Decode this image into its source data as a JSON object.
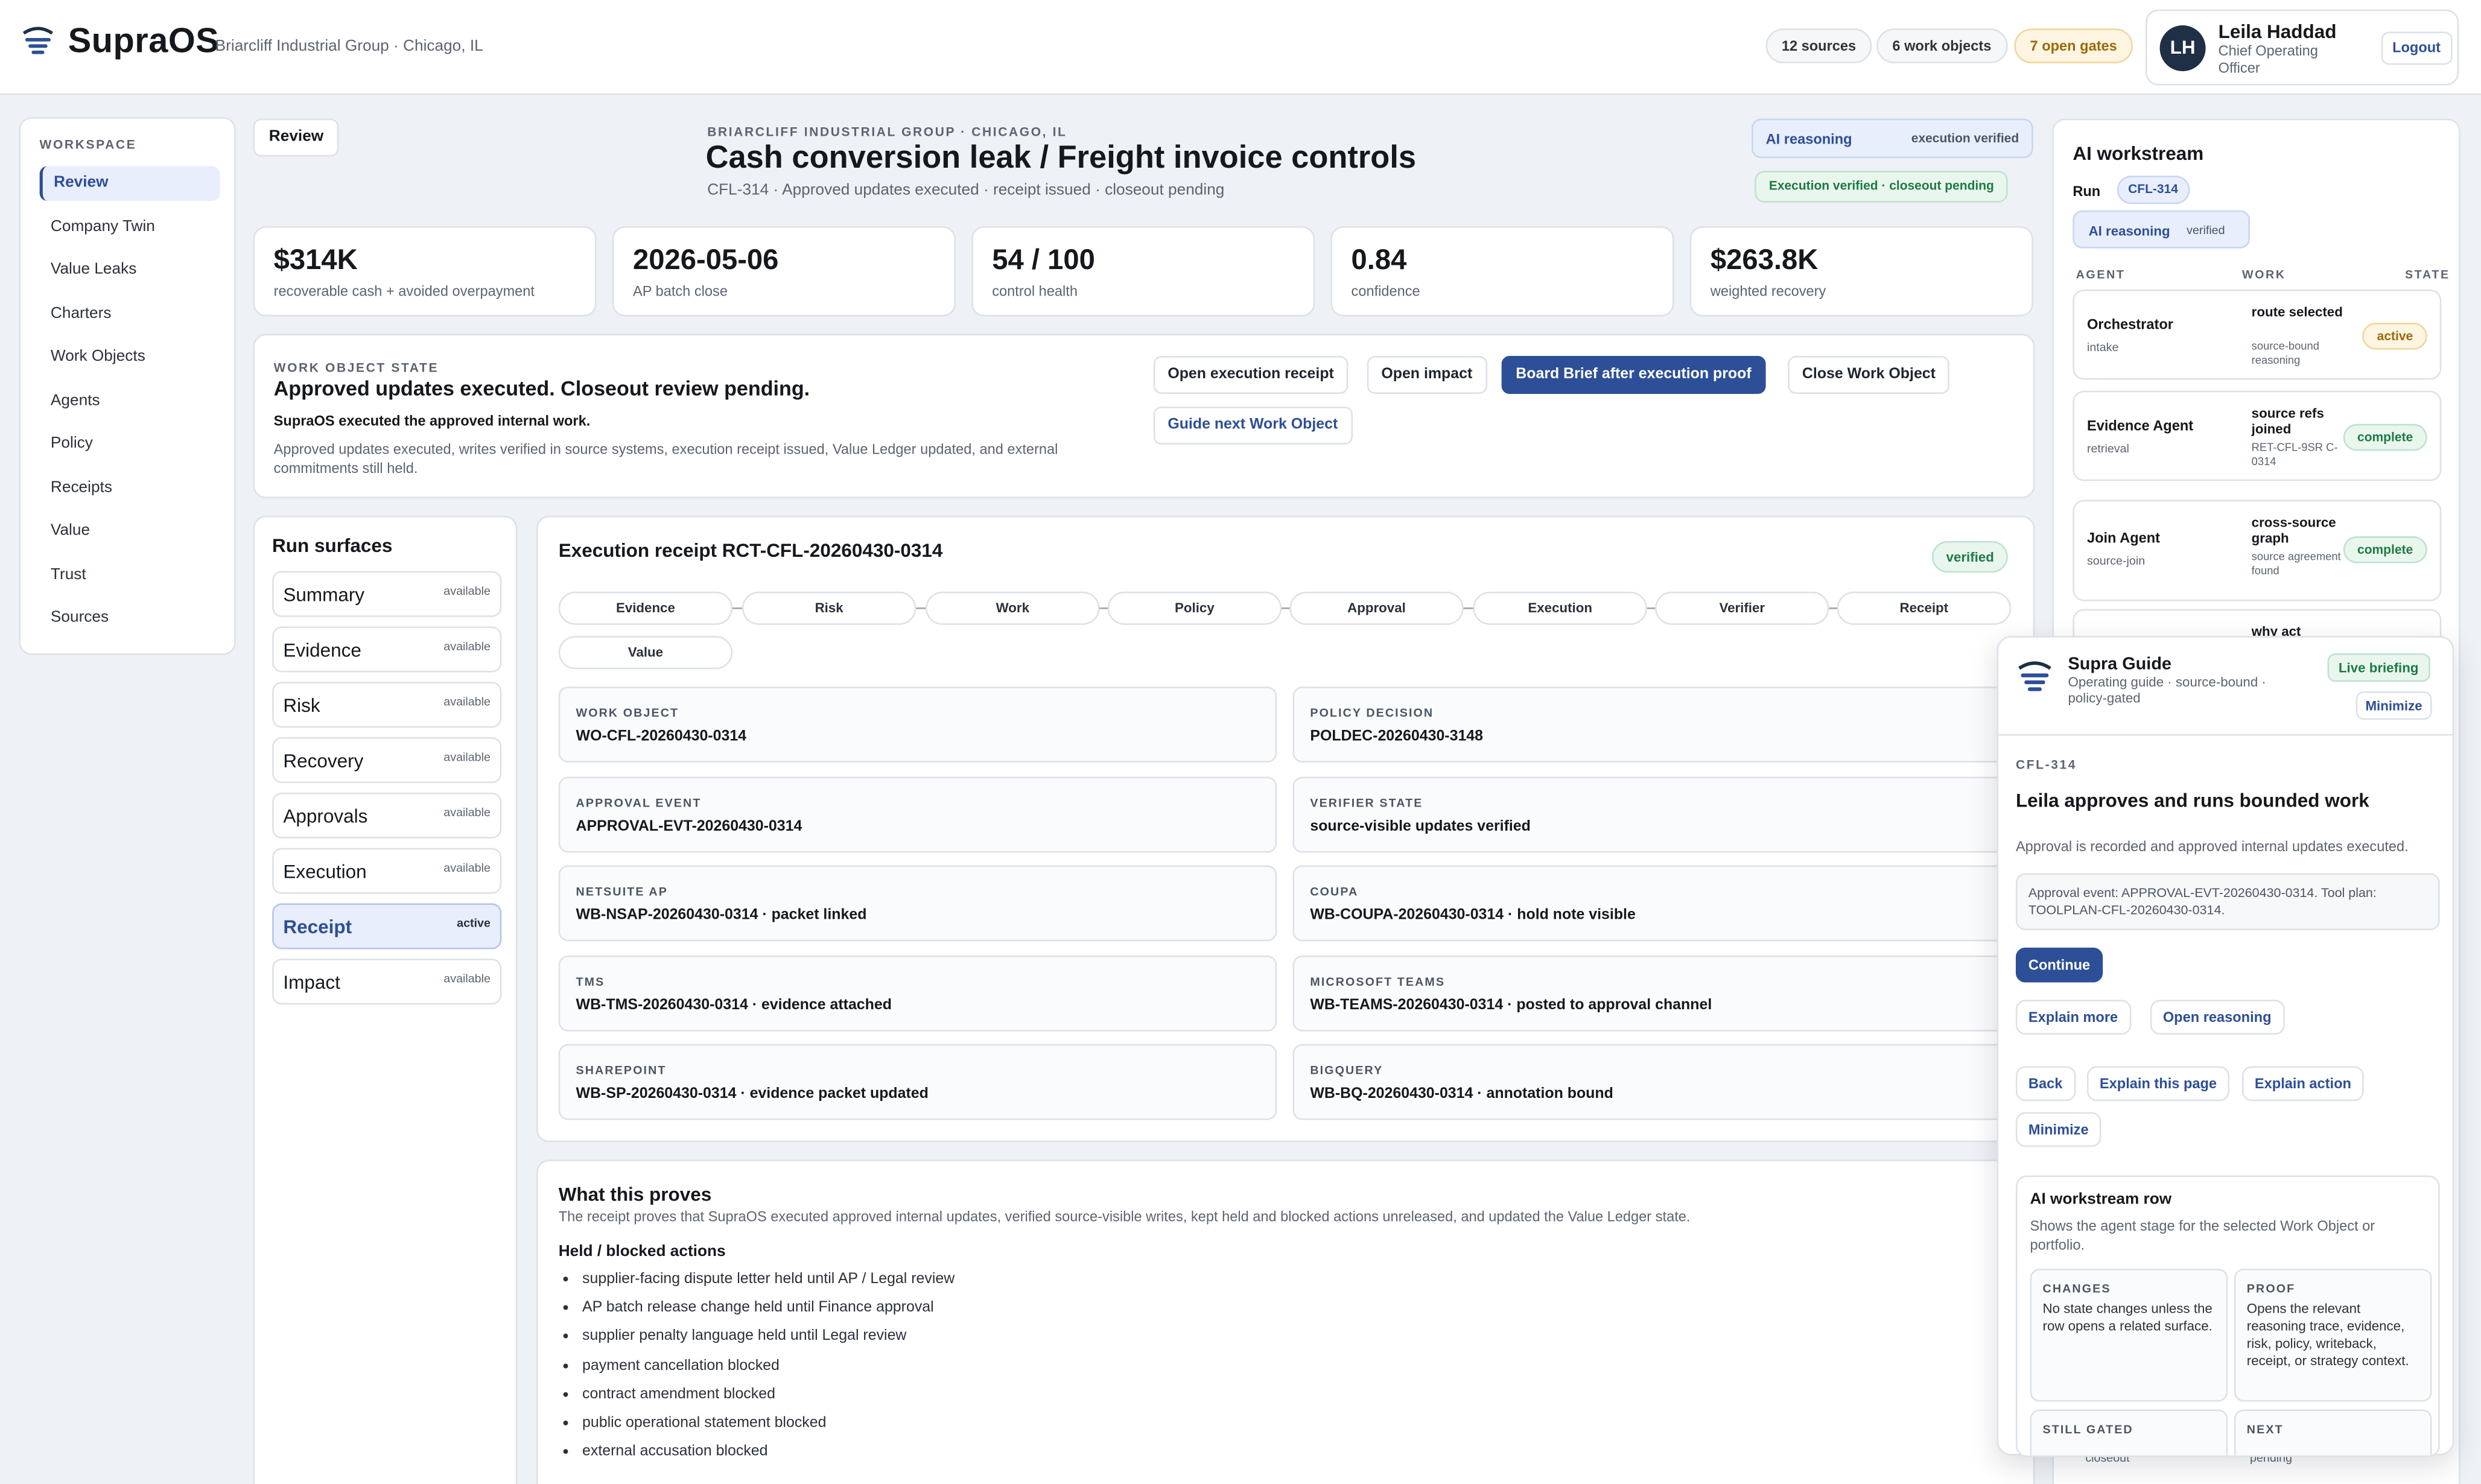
{
  "header": {
    "brand": "SupraOS",
    "org": "Briarcliff Industrial Group · Chicago, IL",
    "chips": [
      "12 sources",
      "6 work objects",
      "7 open gates"
    ],
    "user": {
      "initials": "LH",
      "name": "Leila Haddad",
      "role": "Chief Operating Officer",
      "logout": "Logout"
    }
  },
  "sidebar": {
    "title": "WORKSPACE",
    "items": [
      "Review",
      "Company Twin",
      "Value Leaks",
      "Charters",
      "Work Objects",
      "Agents",
      "Policy",
      "Receipts",
      "Value",
      "Trust",
      "Sources"
    ],
    "active_index": 0
  },
  "main": {
    "review_button": "Review",
    "kicker": "BRIARCLIFF INDUSTRIAL GROUP · CHICAGO, IL",
    "title": "Cash conversion leak / Freight invoice controls",
    "subtitle": "CFL-314 · Approved updates executed · receipt issued · closeout pending",
    "ai_pill": {
      "label": "AI reasoning",
      "state": "execution verified"
    },
    "exec_pill": "Execution verified · closeout pending",
    "metrics": [
      {
        "value": "$314K",
        "label": "recoverable cash + avoided overpayment"
      },
      {
        "value": "2026-05-06",
        "label": "AP batch close"
      },
      {
        "value": "54 / 100",
        "label": "control health"
      },
      {
        "value": "0.84",
        "label": "confidence"
      },
      {
        "value": "$263.8K",
        "label": "weighted recovery"
      }
    ],
    "work_object_state": {
      "kicker": "WORK OBJECT STATE",
      "headline": "Approved updates executed. Closeout review pending.",
      "summary": "SupraOS executed the approved internal work.",
      "detail": "Approved updates executed, writes verified in source systems, execution receipt issued, Value Ledger updated, and external commitments still held.",
      "buttons": [
        "Open execution receipt",
        "Open impact",
        "Board Brief after execution proof",
        "Close Work Object",
        "Guide next Work Object"
      ]
    }
  },
  "run_surfaces": {
    "title": "Run surfaces",
    "items": [
      {
        "name": "Summary",
        "state": "available"
      },
      {
        "name": "Evidence",
        "state": "available"
      },
      {
        "name": "Risk",
        "state": "available"
      },
      {
        "name": "Recovery",
        "state": "available"
      },
      {
        "name": "Approvals",
        "state": "available"
      },
      {
        "name": "Execution",
        "state": "available"
      },
      {
        "name": "Receipt",
        "state": "active"
      },
      {
        "name": "Impact",
        "state": "available"
      }
    ]
  },
  "receipt": {
    "title": "Execution receipt RCT-CFL-20260430-0314",
    "status": "verified",
    "steps": [
      "Evidence",
      "Risk",
      "Work",
      "Policy",
      "Approval",
      "Execution",
      "Verifier",
      "Receipt",
      "Value"
    ],
    "fields": [
      {
        "key": "WORK OBJECT",
        "value": "WO-CFL-20260430-0314"
      },
      {
        "key": "POLICY DECISION",
        "value": "POLDEC-20260430-3148"
      },
      {
        "key": "APPROVAL EVENT",
        "value": "APPROVAL-EVT-20260430-0314"
      },
      {
        "key": "VERIFIER STATE",
        "value": "source-visible updates verified"
      },
      {
        "key": "NETSUITE AP",
        "value": "WB-NSAP-20260430-0314 · packet linked"
      },
      {
        "key": "COUPA",
        "value": "WB-COUPA-20260430-0314 · hold note visible"
      },
      {
        "key": "TMS",
        "value": "WB-TMS-20260430-0314 · evidence attached"
      },
      {
        "key": "MICROSOFT TEAMS",
        "value": "WB-TEAMS-20260430-0314 · posted to approval channel"
      },
      {
        "key": "SHAREPOINT",
        "value": "WB-SP-20260430-0314 · evidence packet updated"
      },
      {
        "key": "BIGQUERY",
        "value": "WB-BQ-20260430-0314 · annotation bound"
      }
    ]
  },
  "proves": {
    "title": "What this proves",
    "description": "The receipt proves that SupraOS executed approved internal updates, verified source-visible writes, kept held and blocked actions unreleased, and updated the Value Ledger state.",
    "held_title": "Held / blocked actions",
    "items": [
      "supplier-facing dispute letter held until AP / Legal review",
      "AP batch release change held until Finance approval",
      "supplier penalty language held until Legal review",
      "payment cancellation blocked",
      "contract amendment blocked",
      "public operational statement blocked",
      "external accusation blocked"
    ]
  },
  "ai_workstream": {
    "title": "AI workstream",
    "run_label": "Run",
    "run_id": "CFL-314",
    "pill": {
      "label": "AI reasoning",
      "state": "verified"
    },
    "columns": [
      "AGENT",
      "WORK",
      "STATE"
    ],
    "rows": [
      {
        "agent": "Orchestrator",
        "role": "intake",
        "work": "route selected",
        "detail": "source-bound reasoning",
        "state": "active"
      },
      {
        "agent": "Evidence Agent",
        "role": "retrieval",
        "work": "source refs joined",
        "detail": "RET-CFL-9SR C-0314",
        "state": "complete"
      },
      {
        "agent": "Join Agent",
        "role": "source-join",
        "work": "cross-source graph",
        "detail": "source agreement found",
        "state": "complete"
      },
      {
        "agent": "",
        "role": "",
        "work": "why act",
        "detail": "",
        "state": ""
      }
    ],
    "bottom_cut": {
      "role": "closeout",
      "detail": "pending"
    }
  },
  "guide": {
    "title": "Supra Guide",
    "subtitle": "Operating guide · source-bound · policy-gated",
    "live": "Live briefing",
    "minimize": "Minimize",
    "kicker": "CFL-314",
    "headline": "Leila approves and runs bounded work",
    "description": "Approval is recorded and approved internal updates executed.",
    "box": "Approval event: APPROVAL-EVT-20260430-0314. Tool plan: TOOLPLAN-CFL-20260430-0314.",
    "buttons": {
      "continue": "Continue",
      "explain_more": "Explain more",
      "open_reasoning": "Open reasoning",
      "back": "Back",
      "explain_page": "Explain this page",
      "explain_action": "Explain action",
      "minimize": "Minimize"
    },
    "row_card": {
      "title": "AI workstream row",
      "description": "Shows the agent stage for the selected Work Object or portfolio.",
      "changes_key": "CHANGES",
      "changes": "No state changes unless the row opens a related surface.",
      "proof_key": "PROOF",
      "proof": "Opens the relevant reasoning trace, evidence, risk, policy, writeback, receipt, or strategy context.",
      "gated_key": "STILL GATED",
      "next_key": "NEXT"
    }
  }
}
